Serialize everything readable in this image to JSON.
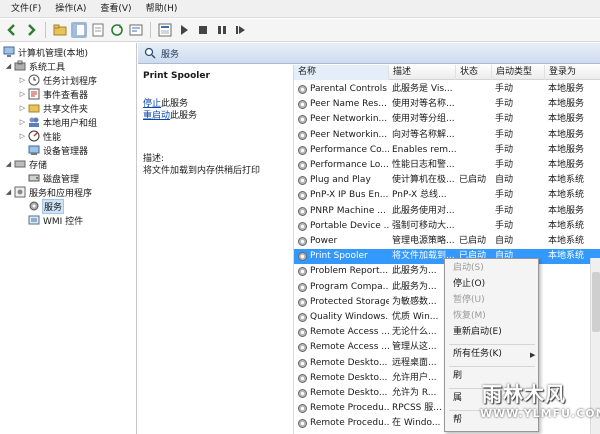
{
  "menubar": {
    "items": [
      "文件(F)",
      "操作(A)",
      "查看(V)",
      "帮助(H)"
    ]
  },
  "toolbar": {
    "icons": [
      "back-icon",
      "forward-icon",
      "up-folder-icon",
      "show-tree-icon",
      "refresh-icon",
      "export-icon",
      "help-icon",
      "properties-icon",
      "play-icon",
      "stop-icon",
      "pause-icon",
      "restart-icon"
    ]
  },
  "tree": {
    "items": [
      {
        "label": "计算机管理(本地)",
        "icon": "computer-icon"
      },
      {
        "label": "系统工具",
        "icon": "tools-icon"
      },
      {
        "label": "任务计划程序",
        "icon": "clock-icon"
      },
      {
        "label": "事件查看器",
        "icon": "event-viewer-icon"
      },
      {
        "label": "共享文件夹",
        "icon": "shared-folder-icon"
      },
      {
        "label": "本地用户和组",
        "icon": "users-icon"
      },
      {
        "label": "性能",
        "icon": "performance-icon"
      },
      {
        "label": "设备管理器",
        "icon": "device-manager-icon"
      },
      {
        "label": "存储",
        "icon": "storage-icon"
      },
      {
        "label": "磁盘管理",
        "icon": "disk-icon"
      },
      {
        "label": "服务和应用程序",
        "icon": "services-apps-icon"
      },
      {
        "label": "服务",
        "icon": "services-icon"
      },
      {
        "label": "WMI 控件",
        "icon": "wmi-icon"
      }
    ]
  },
  "pane": {
    "title": "服务"
  },
  "detail": {
    "service_name": "Print Spooler",
    "stop_link": "停止",
    "stop_suffix": "此服务",
    "restart_link": "重启动",
    "restart_suffix": "此服务",
    "desc_label": "描述:",
    "desc_text": "将文件加载到内存供稍后打印"
  },
  "table": {
    "columns": [
      "名称",
      "描述",
      "状态",
      "启动类型",
      "登录为"
    ],
    "rows": [
      {
        "name": "Parental Controls",
        "desc": "此服务是 Vis...",
        "status": "",
        "startup": "手动",
        "logon": "本地服务"
      },
      {
        "name": "Peer Name Res...",
        "desc": "使用对等名称...",
        "status": "",
        "startup": "手动",
        "logon": "本地服务"
      },
      {
        "name": "Peer Networkin...",
        "desc": "使用对等分组...",
        "status": "",
        "startup": "手动",
        "logon": "本地服务"
      },
      {
        "name": "Peer Networkin...",
        "desc": "向对等名称解...",
        "status": "",
        "startup": "手动",
        "logon": "本地服务"
      },
      {
        "name": "Performance Co...",
        "desc": "Enables rem...",
        "status": "",
        "startup": "手动",
        "logon": "本地服务"
      },
      {
        "name": "Performance Lo...",
        "desc": "性能日志和警...",
        "status": "",
        "startup": "手动",
        "logon": "本地服务"
      },
      {
        "name": "Plug and Play",
        "desc": "使计算机在极...",
        "status": "已启动",
        "startup": "自动",
        "logon": "本地系统"
      },
      {
        "name": "PnP-X IP Bus En...",
        "desc": "PnP-X 总线...",
        "status": "",
        "startup": "手动",
        "logon": "本地系统"
      },
      {
        "name": "PNRP Machine ...",
        "desc": "此服务使用对...",
        "status": "",
        "startup": "手动",
        "logon": "本地服务"
      },
      {
        "name": "Portable Device ...",
        "desc": "强制可移动大...",
        "status": "",
        "startup": "手动",
        "logon": "本地系统"
      },
      {
        "name": "Power",
        "desc": "管理电源策略...",
        "status": "已启动",
        "startup": "自动",
        "logon": "本地系统"
      },
      {
        "name": "Print Spooler",
        "desc": "将文件加载到...",
        "status": "已启动",
        "startup": "自动",
        "logon": "本地系统"
      },
      {
        "name": "Problem Report...",
        "desc": "此服务为...",
        "status": "",
        "startup": "",
        "logon": ""
      },
      {
        "name": "Program Compa...",
        "desc": "此服务为...",
        "status": "",
        "startup": "",
        "logon": ""
      },
      {
        "name": "Protected Storage",
        "desc": "为敏感数...",
        "status": "",
        "startup": "",
        "logon": ""
      },
      {
        "name": "Quality Windows...",
        "desc": "优质 Win...",
        "status": "",
        "startup": "",
        "logon": ""
      },
      {
        "name": "Remote Access ...",
        "desc": "无论什么...",
        "status": "",
        "startup": "",
        "logon": ""
      },
      {
        "name": "Remote Access ...",
        "desc": "管理从这...",
        "status": "",
        "startup": "",
        "logon": ""
      },
      {
        "name": "Remote Deskto...",
        "desc": "远程桌面...",
        "status": "",
        "startup": "",
        "logon": ""
      },
      {
        "name": "Remote Deskto...",
        "desc": "允许用户...",
        "status": "",
        "startup": "",
        "logon": ""
      },
      {
        "name": "Remote Deskto...",
        "desc": "允许为 R...",
        "status": "",
        "startup": "",
        "logon": ""
      },
      {
        "name": "Remote Procedu...",
        "desc": "RPCSS 服...",
        "status": "",
        "startup": "",
        "logon": ""
      },
      {
        "name": "Remote Procedu...",
        "desc": "在 Windo...",
        "status": "",
        "startup": "",
        "logon": ""
      }
    ]
  },
  "context_menu": {
    "start": "启动(S)",
    "stop": "停止(O)",
    "pause": "暂停(U)",
    "resume": "恢复(M)",
    "restart": "重新启动(E)",
    "all_tasks": "所有任务(K)",
    "refresh": "刷",
    "properties": "属",
    "help": "帮"
  },
  "watermark": {
    "brand": "雨林木风",
    "url": "WWW.YLMFU.COM"
  },
  "colors": {
    "selection": "#3399ff",
    "link": "#0645ad",
    "pane_header": "#cfdcee"
  }
}
